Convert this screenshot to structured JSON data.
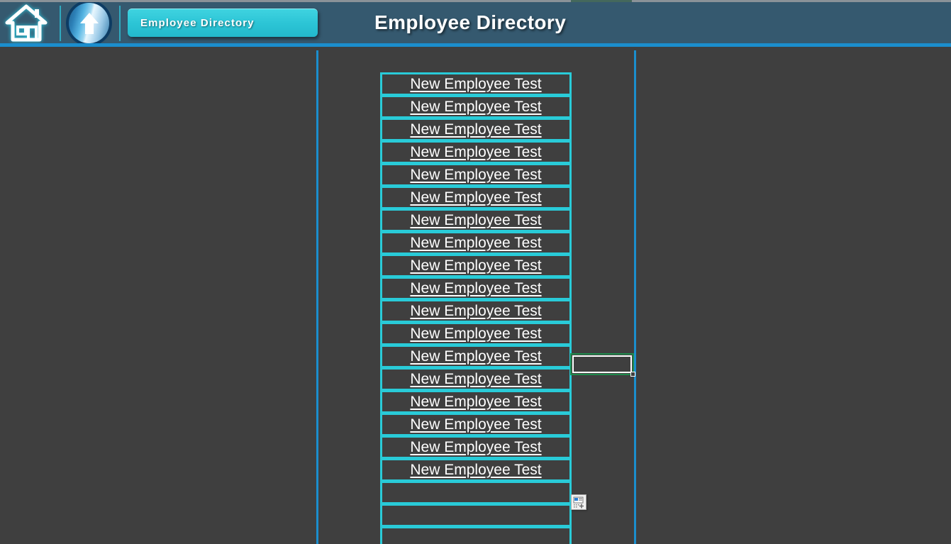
{
  "header": {
    "home_icon": "home-icon",
    "up_icon": "up-arrow-icon",
    "breadcrumb_label": "Employee Directory",
    "page_title": "Employee Directory",
    "accent_color": "#1b8ecd",
    "crumb_color": "#2cc5d6",
    "bg_color": "#35596f"
  },
  "top_strip": {
    "bar_color": "#8a9298",
    "segment_color": "#44685c"
  },
  "canvas": {
    "bg_color": "#3f3f3f",
    "divider_color": "#1b8ecd"
  },
  "list": {
    "border_color": "#29cbd8",
    "text_color": "#ffffff",
    "rows": [
      {
        "label": "New Employee Test"
      },
      {
        "label": "New Employee Test"
      },
      {
        "label": "New Employee Test"
      },
      {
        "label": "New Employee Test"
      },
      {
        "label": "New Employee Test"
      },
      {
        "label": "New Employee Test"
      },
      {
        "label": "New Employee Test"
      },
      {
        "label": "New Employee Test"
      },
      {
        "label": "New Employee Test"
      },
      {
        "label": "New Employee Test"
      },
      {
        "label": "New Employee Test"
      },
      {
        "label": "New Employee Test"
      },
      {
        "label": "New Employee Test"
      },
      {
        "label": "New Employee Test"
      },
      {
        "label": "New Employee Test"
      },
      {
        "label": "New Employee Test"
      },
      {
        "label": "New Employee Test"
      },
      {
        "label": "New Employee Test"
      },
      {
        "label": ""
      },
      {
        "label": ""
      },
      {
        "label": ""
      }
    ]
  },
  "selection": {
    "value": "",
    "border_color": "#1f8a4c"
  },
  "paste_options": {
    "icon": "paste-options-icon"
  }
}
